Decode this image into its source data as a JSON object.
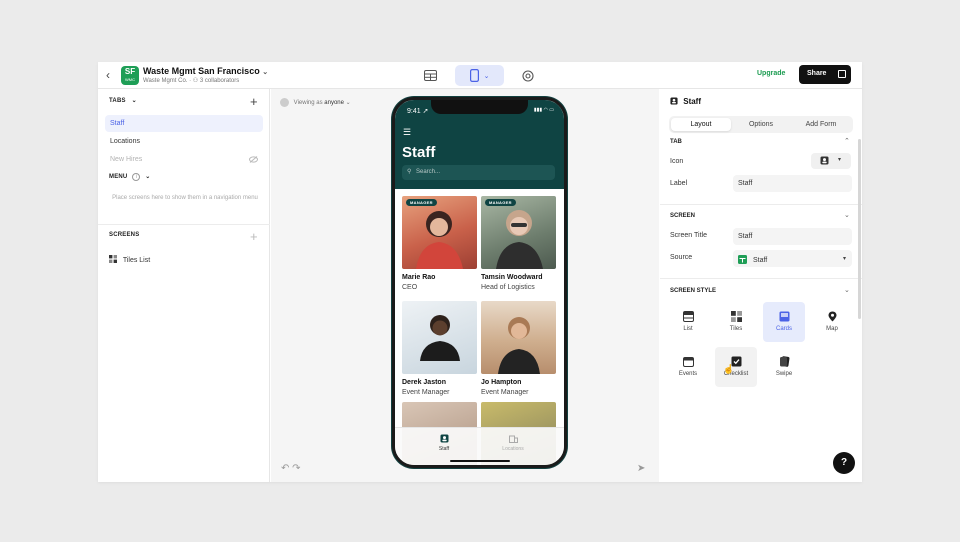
{
  "header": {
    "back_icon": "chevron-left-icon",
    "logo_text": "SF",
    "logo_sub": "WMC",
    "app_title": "Waste Mgmt San Francisco",
    "org": "Waste Mgmt Co.",
    "collaborators": "3 collaborators",
    "view_tabs": [
      {
        "name": "data",
        "icon": "table-icon",
        "active": false
      },
      {
        "name": "layout",
        "icon": "phone-icon",
        "active": true
      },
      {
        "name": "settings",
        "icon": "gear-icon",
        "active": false
      }
    ],
    "upgrade_label": "Upgrade",
    "share_label": "Share"
  },
  "left_panel": {
    "tabs_heading": "TABS",
    "tabs": [
      {
        "label": "Staff",
        "state": "active"
      },
      {
        "label": "Locations",
        "state": "normal"
      },
      {
        "label": "New Hires",
        "state": "hidden"
      }
    ],
    "menu_heading": "MENU",
    "menu_hint": "Place screens here to show them in a navigation menu",
    "screens_heading": "SCREENS",
    "screens": [
      {
        "label": "Tiles List",
        "icon": "tiles-icon"
      }
    ]
  },
  "canvas": {
    "viewing_prefix": "Viewing as",
    "viewing_user": "anyone",
    "phone": {
      "time": "9:41",
      "screen_title": "Staff",
      "search_placeholder": "Search...",
      "cards": [
        {
          "name": "Marie Rao",
          "role": "CEO",
          "badge": "MANAGER",
          "color": "#d9805f"
        },
        {
          "name": "Tamsin Woodward",
          "role": "Head of Logistics",
          "badge": "MANAGER",
          "color": "#7b8a7a"
        },
        {
          "name": "Derek Jaston",
          "role": "Event Manager",
          "badge": "",
          "color": "#c9d6de"
        },
        {
          "name": "Jo Hampton",
          "role": "Event Manager",
          "badge": "",
          "color": "#c9a98b"
        },
        {
          "name": "",
          "role": "",
          "badge": "",
          "color": "#b9a393"
        },
        {
          "name": "",
          "role": "",
          "badge": "",
          "color": "#8f8c6a"
        }
      ],
      "tab_bar": [
        {
          "label": "Staff",
          "icon": "person-icon",
          "active": true
        },
        {
          "label": "Locations",
          "icon": "building-icon",
          "active": false
        }
      ]
    }
  },
  "right_panel": {
    "title": "Staff",
    "segments": [
      {
        "label": "Layout",
        "active": true
      },
      {
        "label": "Options",
        "active": false
      },
      {
        "label": "Add Form",
        "active": false
      }
    ],
    "tab_section": {
      "heading": "TAB",
      "icon_label": "Icon",
      "label_label": "Label",
      "label_value": "Staff"
    },
    "screen_section": {
      "heading": "SCREEN",
      "title_label": "Screen Title",
      "title_value": "Staff",
      "source_label": "Source",
      "source_value": "Staff"
    },
    "style_section": {
      "heading": "SCREEN STYLE",
      "styles": [
        {
          "label": "List",
          "icon": "list-icon",
          "state": "normal"
        },
        {
          "label": "Tiles",
          "icon": "tiles-icon",
          "state": "normal"
        },
        {
          "label": "Cards",
          "icon": "cards-icon",
          "state": "active"
        },
        {
          "label": "Map",
          "icon": "map-pin-icon",
          "state": "normal"
        },
        {
          "label": "Events",
          "icon": "calendar-icon",
          "state": "normal"
        },
        {
          "label": "Checklist",
          "icon": "checkbox-icon",
          "state": "hover"
        },
        {
          "label": "Swipe",
          "icon": "swipe-icon",
          "state": "normal"
        }
      ]
    }
  },
  "help_label": "?"
}
